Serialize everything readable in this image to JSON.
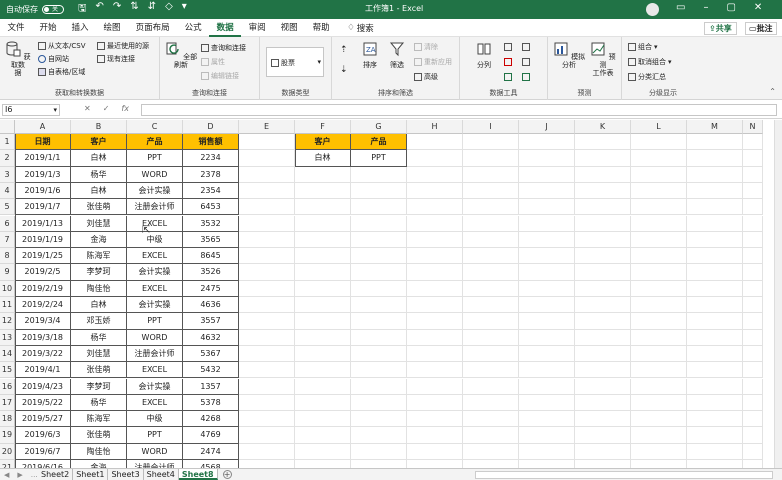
{
  "titlebar": {
    "autosave_label": "自动保存",
    "autosave_state": "关",
    "title": "工作簿1 - Excel"
  },
  "menu": {
    "tabs": [
      "文件",
      "开始",
      "插入",
      "绘图",
      "页面布局",
      "公式",
      "数据",
      "审阅",
      "视图",
      "帮助"
    ],
    "active": "数据",
    "search": "搜索",
    "share": "共享",
    "comment": "批注"
  },
  "ribbon": {
    "groups": {
      "get_data": {
        "label": "获取和转换数据",
        "big": "获取数\n据",
        "from_text": "从文本/CSV",
        "from_web": "自网站",
        "from_table": "自表格/区域",
        "recent": "最近使用的源",
        "existing": "现有连接"
      },
      "queries": {
        "label": "查询和连接",
        "refresh": "全部刷新",
        "queries": "查询和连接",
        "props": "属性",
        "edit_links": "编辑链接"
      },
      "datatypes": {
        "label": "数据类型",
        "stock": "股票"
      },
      "sort": {
        "label": "排序和筛选",
        "sort": "排序",
        "filter": "筛选",
        "clear": "清除",
        "reapply": "重新应用",
        "advanced": "高级"
      },
      "tools": {
        "label": "数据工具",
        "split": "分列"
      },
      "forecast": {
        "label": "预测",
        "whatif": "模拟分析",
        "sheet": "预测\n工作表"
      },
      "outline": {
        "label": "分级显示",
        "group": "组合",
        "ungroup": "取消组合",
        "subtotal": "分类汇总"
      }
    }
  },
  "formula_bar": {
    "name_box": "I6",
    "formula": ""
  },
  "columns": [
    "A",
    "B",
    "C",
    "D",
    "E",
    "F",
    "G",
    "H",
    "I",
    "J",
    "K",
    "L",
    "M",
    "N"
  ],
  "rows": [
    "1",
    "2",
    "3",
    "4",
    "5",
    "6",
    "7",
    "8",
    "9",
    "10",
    "11",
    "12",
    "13",
    "14",
    "15",
    "16",
    "17",
    "18",
    "19",
    "20",
    "21"
  ],
  "table1": {
    "headers": [
      "日期",
      "客户",
      "产品",
      "销售额"
    ],
    "rows": [
      [
        "2019/1/1",
        "白林",
        "PPT",
        "2234"
      ],
      [
        "2019/1/3",
        "杨华",
        "WORD",
        "2378"
      ],
      [
        "2019/1/6",
        "白林",
        "会计实操",
        "2354"
      ],
      [
        "2019/1/7",
        "张佳萌",
        "注册会计师",
        "6453"
      ],
      [
        "2019/1/13",
        "刘佳慧",
        "EXCEL",
        "3532"
      ],
      [
        "2019/1/19",
        "金海",
        "中级",
        "3565"
      ],
      [
        "2019/1/25",
        "陈海军",
        "EXCEL",
        "8645"
      ],
      [
        "2019/2/5",
        "李梦珂",
        "会计实操",
        "3526"
      ],
      [
        "2019/2/19",
        "陶佳怡",
        "EXCEL",
        "2475"
      ],
      [
        "2019/2/24",
        "白林",
        "会计实操",
        "4636"
      ],
      [
        "2019/3/4",
        "邓玉娇",
        "PPT",
        "3557"
      ],
      [
        "2019/3/18",
        "杨华",
        "WORD",
        "4632"
      ],
      [
        "2019/3/22",
        "刘佳慧",
        "注册会计师",
        "5367"
      ],
      [
        "2019/4/1",
        "张佳萌",
        "EXCEL",
        "5432"
      ],
      [
        "2019/4/23",
        "李梦珂",
        "会计实操",
        "1357"
      ],
      [
        "2019/5/22",
        "杨华",
        "EXCEL",
        "5378"
      ],
      [
        "2019/5/27",
        "陈海军",
        "中级",
        "4268"
      ],
      [
        "2019/6/3",
        "张佳萌",
        "PPT",
        "4769"
      ],
      [
        "2019/6/7",
        "陶佳怡",
        "WORD",
        "2474"
      ],
      [
        "2019/6/16",
        "金海",
        "注册会计师",
        "4568"
      ]
    ]
  },
  "table2": {
    "headers": [
      "客户",
      "产品"
    ],
    "rows": [
      [
        "白林",
        "PPT"
      ]
    ]
  },
  "sheets": [
    "Sheet2",
    "Sheet1",
    "Sheet3",
    "Sheet4",
    "Sheet8"
  ],
  "active_sheet": "Sheet8",
  "colors": {
    "brand": "#217346",
    "header_fill": "#ffc000"
  }
}
